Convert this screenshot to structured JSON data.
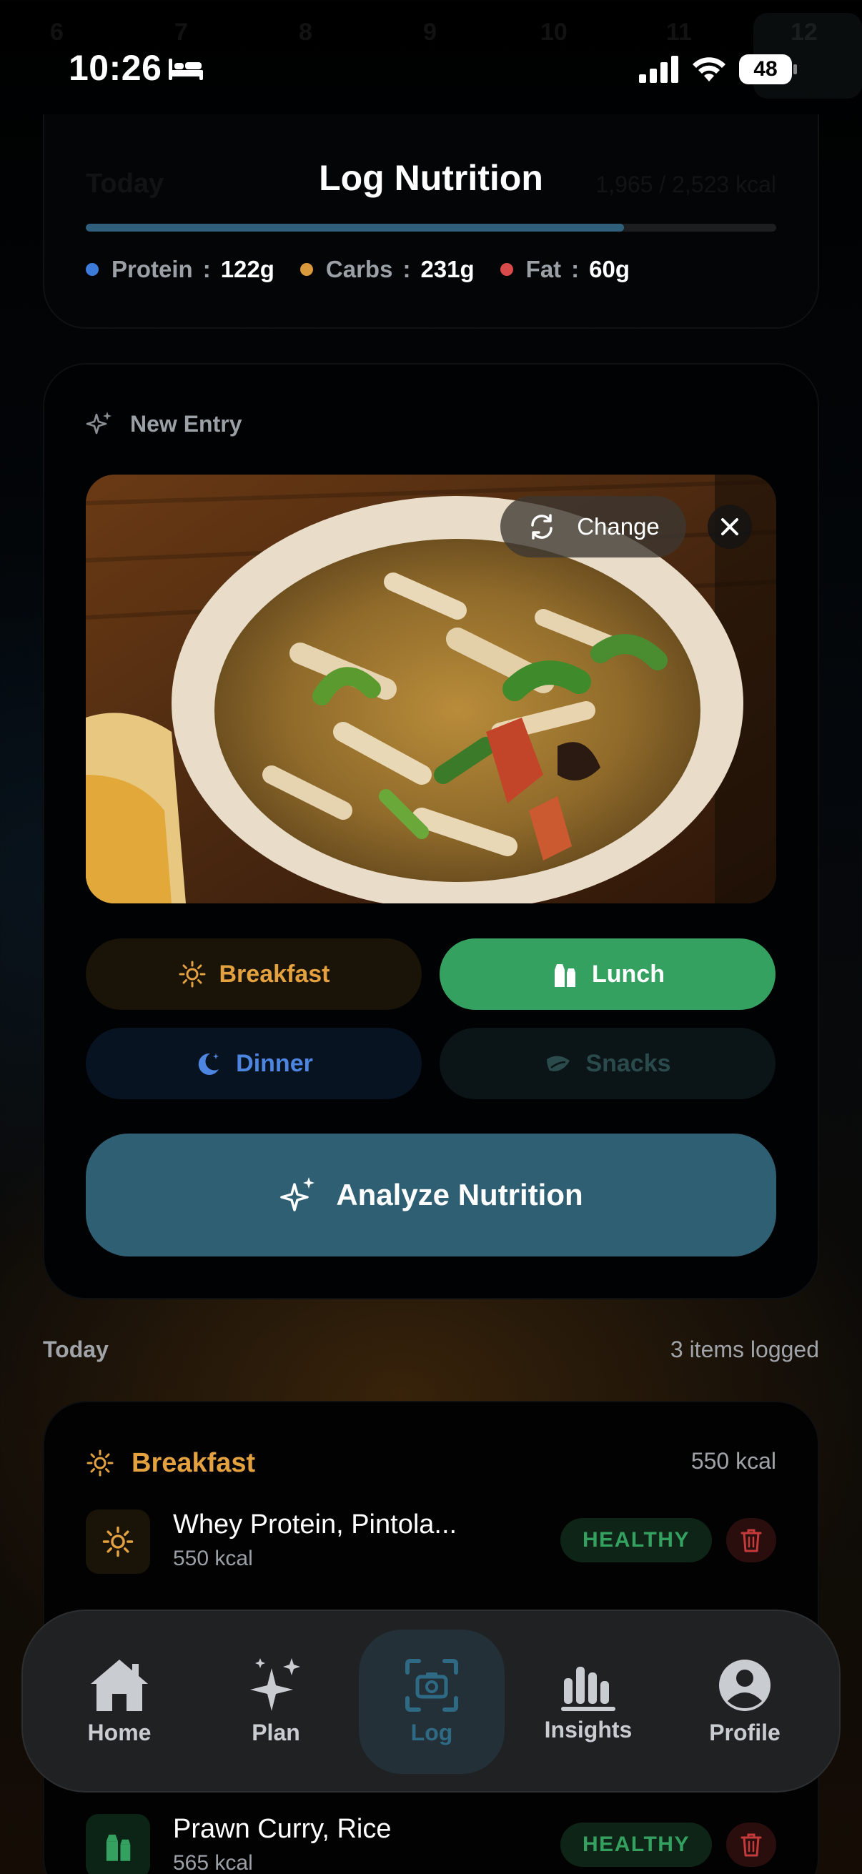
{
  "status_bar": {
    "time": "10:26",
    "battery": "48",
    "date_strip": [
      "6",
      "7",
      "8",
      "9",
      "10",
      "11",
      "12"
    ]
  },
  "summary": {
    "left_faded": "Today",
    "title": "Log Nutrition",
    "right_faded": "1,965 / 2,523 kcal",
    "progress_fraction": 0.78,
    "macros": [
      {
        "label": "Protein",
        "sep": ":",
        "value": "122g",
        "color": "#3d7bd9"
      },
      {
        "label": "Carbs",
        "sep": ":",
        "value": "231g",
        "color": "#d99a3d"
      },
      {
        "label": "Fat",
        "sep": ":",
        "value": "60g",
        "color": "#d94a4a"
      }
    ]
  },
  "entry": {
    "header": "New Entry",
    "change_label": "Change",
    "meal_types": {
      "breakfast": "Breakfast",
      "lunch": "Lunch",
      "dinner": "Dinner",
      "snacks": "Snacks"
    },
    "selected_meal": "Lunch",
    "analyze_label": "Analyze Nutrition"
  },
  "today": {
    "label": "Today",
    "count": "3 items logged",
    "breakfast_title": "Breakfast",
    "breakfast_kcal": "550 kcal",
    "items": [
      {
        "name": "Whey Protein, Pintola...",
        "kcal": "550 kcal",
        "badge": "HEALTHY"
      },
      {
        "name": "Prawn Curry, Rice",
        "kcal": "565 kcal",
        "badge": "HEALTHY"
      }
    ]
  },
  "nav": {
    "home": "Home",
    "plan": "Plan",
    "log": "Log",
    "insights": "Insights",
    "profile": "Profile"
  },
  "colors": {
    "accent": "#2f5f73",
    "lunch_active": "#35a160",
    "breakfast": "#e3a140",
    "dinner": "#4d86e0"
  }
}
